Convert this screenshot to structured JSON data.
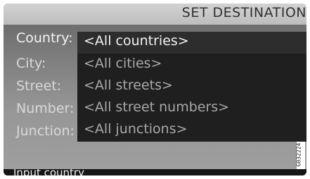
{
  "header": {
    "title": "SET DESTINATION"
  },
  "form": {
    "labels": {
      "country": "Country:",
      "city": "City:",
      "street": "Street:",
      "number": "Number:",
      "junction": "Junction:"
    }
  },
  "list": {
    "items": [
      {
        "label": "<All countries>",
        "selected": true
      },
      {
        "label": "<All cities>"
      },
      {
        "label": "<All streets>"
      },
      {
        "label": "<All street numbers>"
      },
      {
        "label": "<All junctions>"
      }
    ]
  },
  "image_code": "G032224",
  "status_bar": {
    "text": "Input country"
  }
}
